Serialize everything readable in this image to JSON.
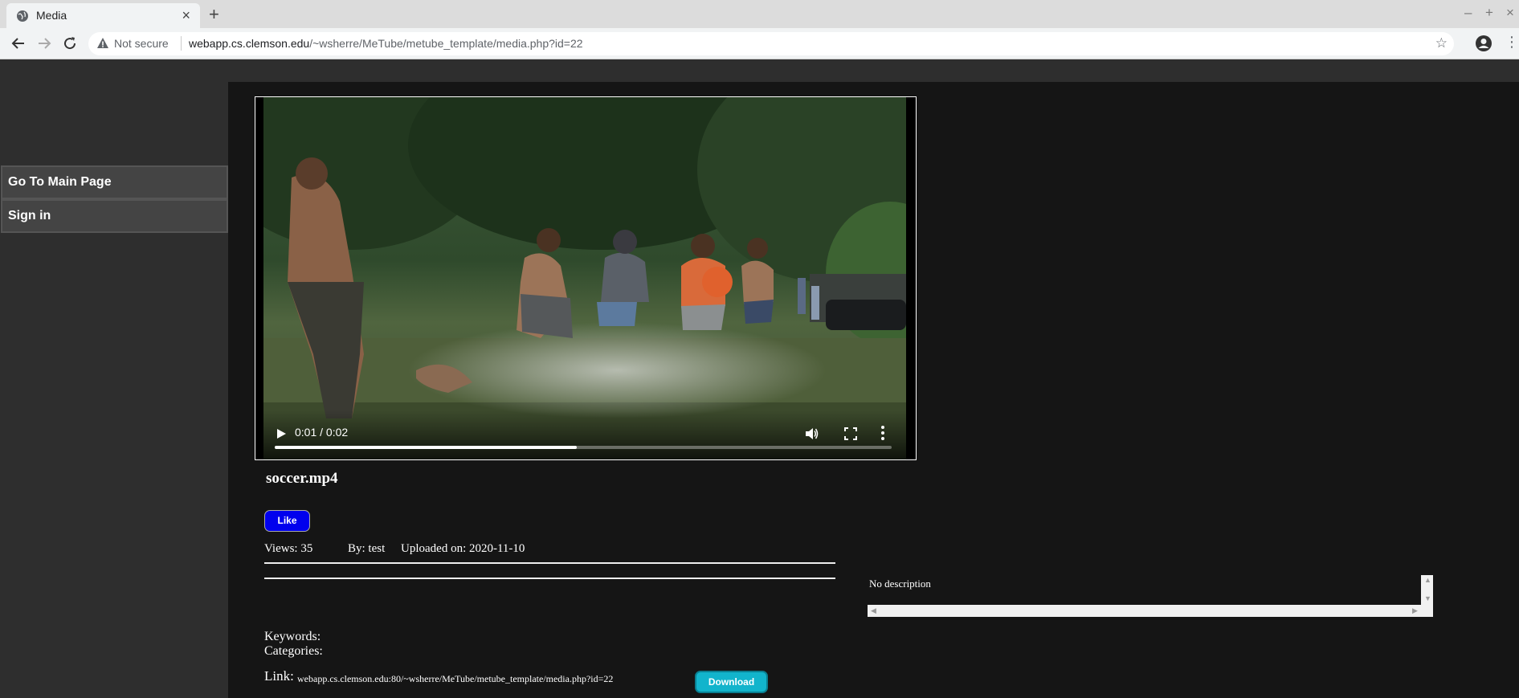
{
  "browser": {
    "tab_title": "Media",
    "new_tab_symbol": "+",
    "close_symbol": "×",
    "window_controls": [
      "–",
      "+",
      "×"
    ],
    "security_label": "Not secure",
    "url_host": "webapp.cs.clemson.edu",
    "url_path": "/~wsherre/MeTube/metube_template/media.php?id=22",
    "bookmark_symbol": "☆",
    "menu_symbol": "⋮"
  },
  "sidebar": {
    "items": [
      {
        "label": "Go To Main Page"
      },
      {
        "label": "Sign in"
      }
    ]
  },
  "player": {
    "time": "0:01 / 0:02",
    "progress": 0.49
  },
  "media": {
    "title": "soccer.mp4",
    "like_label": "Like",
    "views": "Views: 35",
    "by": "By: test",
    "uploaded": "Uploaded on: 2020-11-10",
    "description": "No description",
    "keywords_label": "Keywords:",
    "categories_label": "Categories:",
    "link_label": "Link:",
    "link_url": "webapp.cs.clemson.edu:80/~wsherre/MeTube/metube_template/media.php?id=22",
    "download_label": "Download"
  },
  "icons": {
    "favicon": "globe-icon",
    "warning": "warning-icon",
    "play": "play-icon",
    "volume": "volume-icon",
    "fullscreen": "fullscreen-icon",
    "more": "more-options-icon",
    "profile": "account-icon"
  },
  "colors": {
    "like_button": "#0000ee",
    "download_button": "#12b4cc",
    "main_background": "#151515",
    "sidebar_background": "#2e2e2e"
  }
}
